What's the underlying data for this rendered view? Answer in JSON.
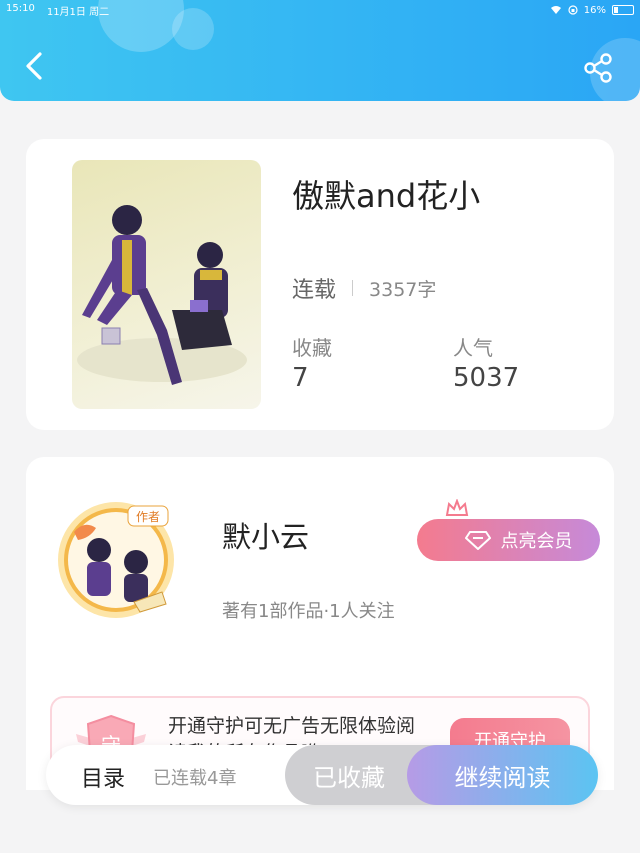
{
  "status_bar": {
    "time": "15:10",
    "date": "11月1日 周二",
    "battery": "16%"
  },
  "header": {
    "back_icon": "chevron-left-icon",
    "share_icon": "share-icon"
  },
  "book": {
    "title": "傲默and花小",
    "status": "连载",
    "word_count": "3357字",
    "favorites_label": "收藏",
    "favorites_value": "7",
    "popularity_label": "人气",
    "popularity_value": "5037"
  },
  "author": {
    "name": "默小云",
    "badge_text": "作者",
    "meta": "著有1部作品·1人关注",
    "vip_button": "点亮会员"
  },
  "guard": {
    "text": "开通守护可无广告无限体验阅读我的所有作品哟",
    "badge": "守",
    "button": "开通守护"
  },
  "bottom_bar": {
    "toc_label": "目录",
    "toc_meta": "已连载4章",
    "favorited_button": "已收藏",
    "continue_button": "继续阅读"
  },
  "colors": {
    "header": "#2aa6f5",
    "vip": "#f47b8e",
    "read_button": "#5bc4f2"
  }
}
